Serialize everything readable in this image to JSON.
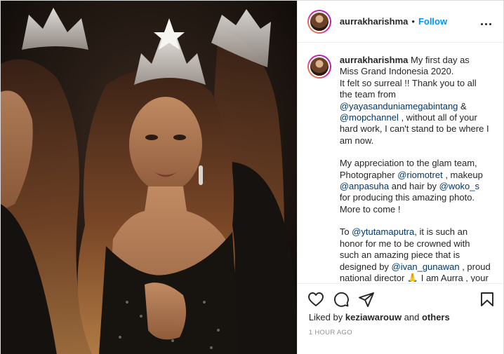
{
  "post": {
    "username": "aurrakharishma",
    "separator": "•",
    "follow_label": "Follow",
    "more_icon": "more-options-icon"
  },
  "caption": {
    "username": "aurrakharishma",
    "p1a": "My first day as Miss Grand Indonesia 2020.",
    "p1b": "It felt so surreal !! Thank you to all the team from ",
    "m1": "@yayasanduniamegabintang",
    "p1c": " & ",
    "m2": "@mopchannel",
    "p1d": " , without all of your hard work, I can't stand to be where I am now.",
    "p2a": "My appreciation to the glam team, Photographer ",
    "m3": "@riomotret",
    "p2b": " , makeup ",
    "m4": "@anpasuha",
    "p2c": " and hair by ",
    "m5": "@woko_s",
    "p2d": " for producing this amazing photo. More to come !",
    "p3a": "To ",
    "m6": "@ytutamaputra",
    "p3b": ", it is such an honor for me to be crowned with such an amazing piece that is designed by ",
    "m7": "@ivan_gunawan",
    "p3c": " , proud national director 🙏 I am Aurra , your Miss"
  },
  "actions": {
    "like_icon": "heart-icon",
    "comment_icon": "comment-icon",
    "share_icon": "share-icon",
    "save_icon": "bookmark-icon"
  },
  "likes": {
    "prefix": "Liked by ",
    "user": "keziawarouw",
    "middle": " and ",
    "others": "others"
  },
  "time": "1 HOUR AGO",
  "colors": {
    "link": "#0095f6",
    "mention": "#00376b",
    "muted": "#8e8e8e"
  }
}
